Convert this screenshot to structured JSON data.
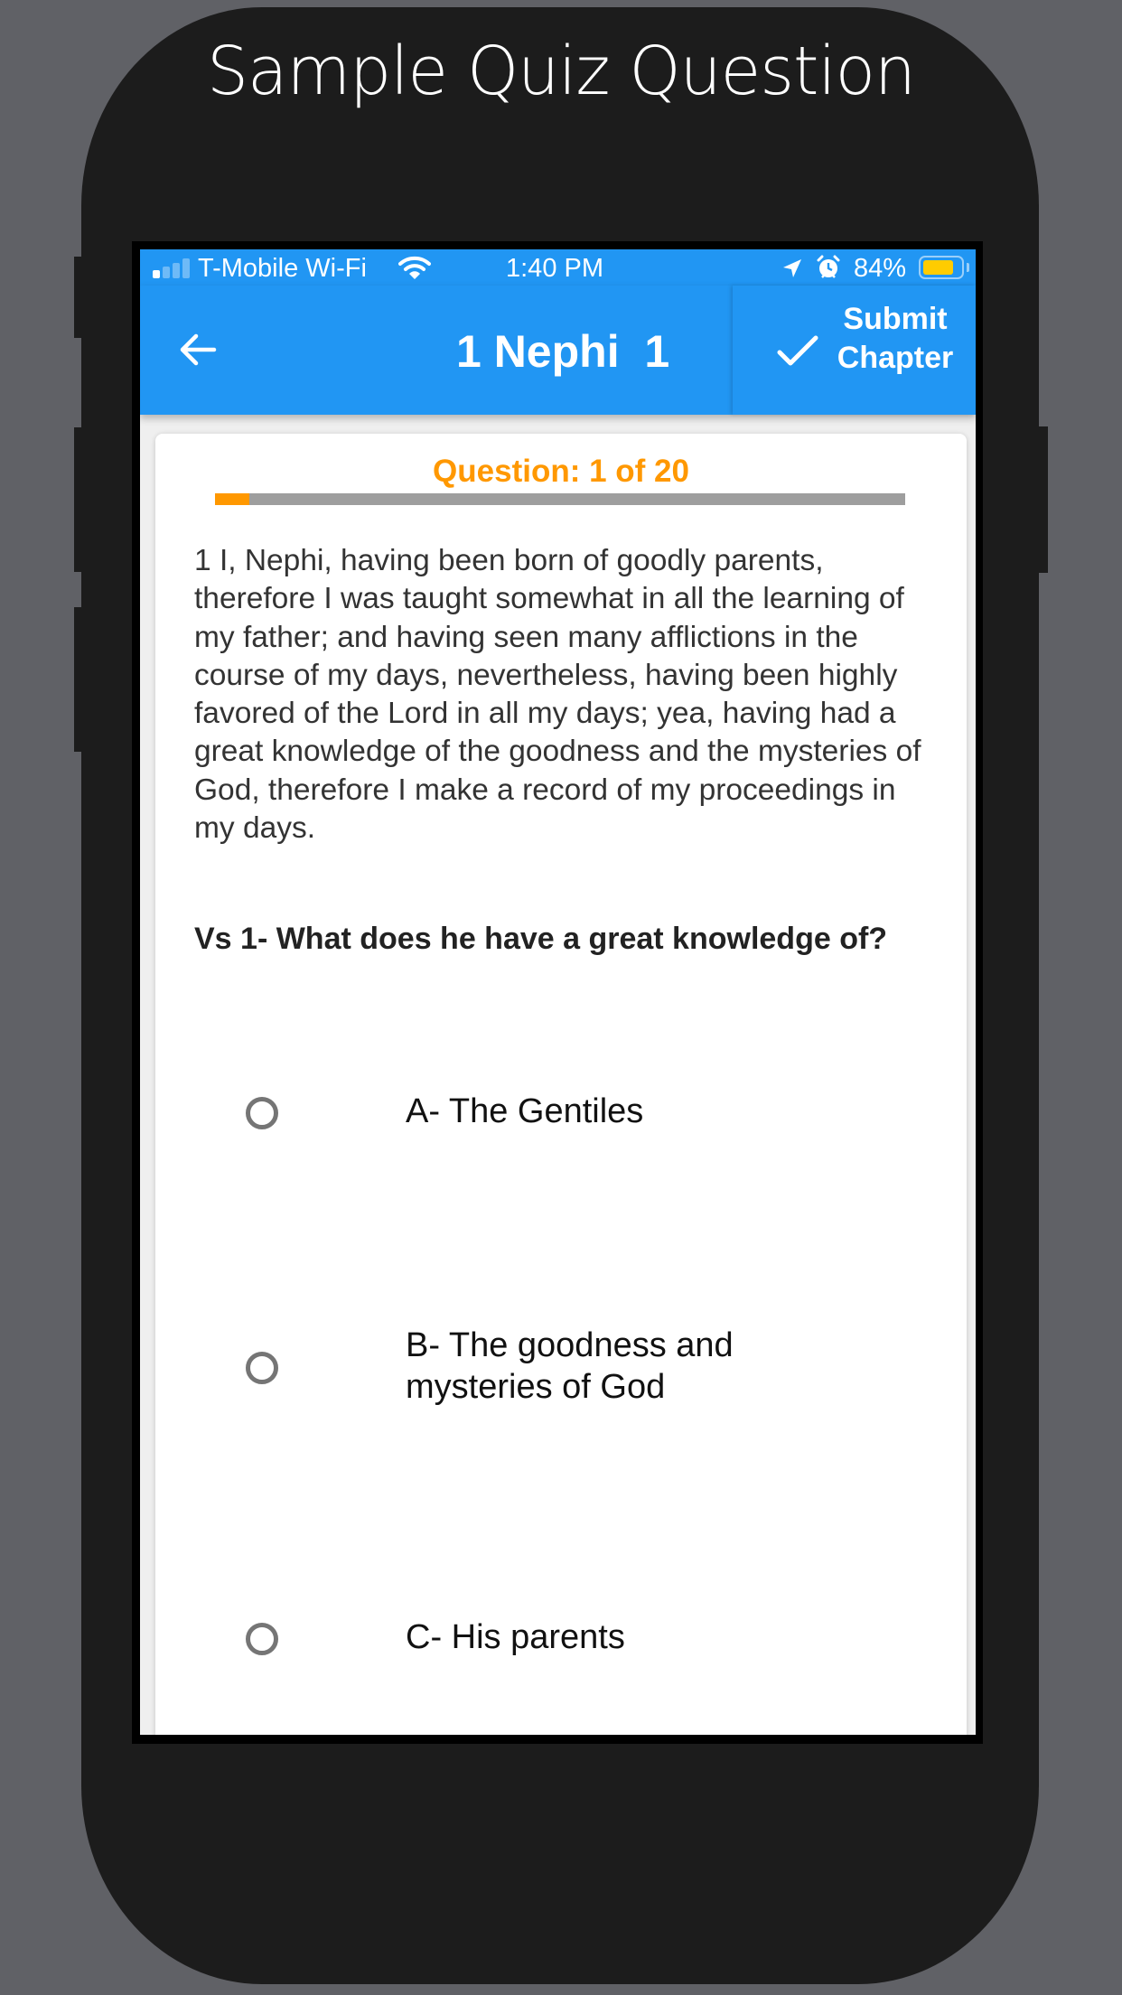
{
  "headline": "Sample Quiz Question",
  "status_bar": {
    "carrier": "T-Mobile Wi-Fi",
    "time": "1:40 PM",
    "battery_percent_label": "84%",
    "battery_level": 0.84,
    "signal_bars_active": 1,
    "signal_bars_total": 4,
    "icons": [
      "signal-icon",
      "wifi-icon",
      "location-arrow-icon",
      "alarm-icon",
      "battery-icon"
    ]
  },
  "app_bar": {
    "back_icon": "arrow-left-icon",
    "title": "1 Nephi  1",
    "submit_icon": "check-icon",
    "submit_label": "Submit Chapter",
    "color": "#2196F3"
  },
  "quiz": {
    "counter_label": "Question: 1 of 20",
    "current": 1,
    "total": 20,
    "progress_fraction": 0.05,
    "accent_color": "#FF9800",
    "verse_text": "1 I, Nephi, having been born of goodly parents, therefore I was taught somewhat in all the learning of my father; and having seen many afflictions in the course of my days, nevertheless, having been highly favored of the Lord in all my days; yea, having had a great knowledge of the goodness and the mysteries of God, therefore I make a record of my proceedings in my days.",
    "question_text": "Vs 1- What does he have a great knowledge of?",
    "options": [
      {
        "label": "A- The Gentiles",
        "selected": false
      },
      {
        "label": "B- The goodness and mysteries of God",
        "selected": false
      },
      {
        "label": "C- His parents",
        "selected": false
      }
    ]
  }
}
